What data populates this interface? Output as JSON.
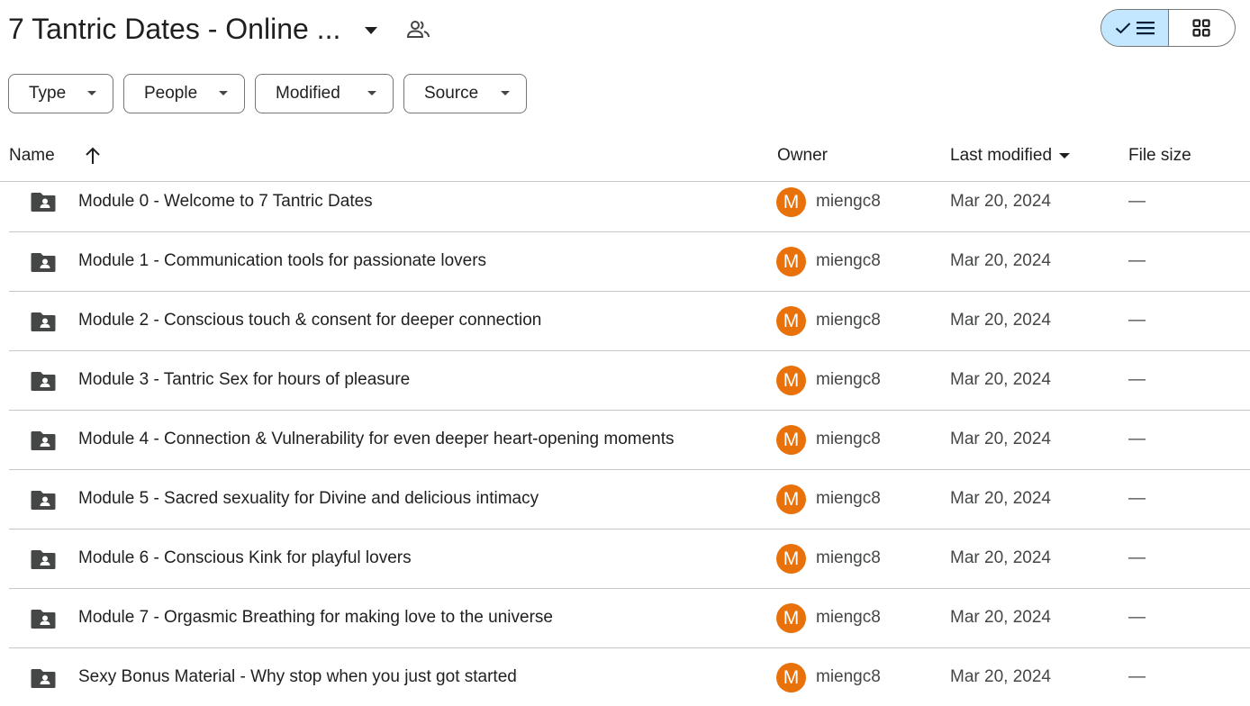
{
  "header": {
    "title": "7 Tantric Dates - Online ...",
    "caret_icon": "arrow-drop-down-icon",
    "shared_icon": "people-outline-icon",
    "view_toggle": {
      "list_icon": "check-list-icon",
      "grid_icon": "grid-view-icon",
      "selected": "list"
    }
  },
  "filters": [
    {
      "label": "Type"
    },
    {
      "label": "People"
    },
    {
      "label": "Modified"
    },
    {
      "label": "Source"
    }
  ],
  "columns": {
    "name": "Name",
    "owner": "Owner",
    "last_modified": "Last modified",
    "file_size": "File size",
    "sort_icon": "arrow-upward-icon"
  },
  "rows": [
    {
      "name": "Module 0 - Welcome to 7 Tantric Dates",
      "owner_initial": "M",
      "owner": "miengc8",
      "modified": "Mar 20, 2024",
      "size": "—"
    },
    {
      "name": "Module 1 - Communication tools for passionate lovers",
      "owner_initial": "M",
      "owner": "miengc8",
      "modified": "Mar 20, 2024",
      "size": "—"
    },
    {
      "name": "Module 2 - Conscious touch & consent for deeper connection",
      "owner_initial": "M",
      "owner": "miengc8",
      "modified": "Mar 20, 2024",
      "size": "—"
    },
    {
      "name": "Module 3 - Tantric Sex for hours of pleasure",
      "owner_initial": "M",
      "owner": "miengc8",
      "modified": "Mar 20, 2024",
      "size": "—"
    },
    {
      "name": "Module 4 - Connection & Vulnerability for even deeper heart-opening moments",
      "owner_initial": "M",
      "owner": "miengc8",
      "modified": "Mar 20, 2024",
      "size": "—"
    },
    {
      "name": "Module 5 - Sacred sexuality for Divine and delicious intimacy",
      "owner_initial": "M",
      "owner": "miengc8",
      "modified": "Mar 20, 2024",
      "size": "—"
    },
    {
      "name": "Module 6 - Conscious Kink for playful lovers",
      "owner_initial": "M",
      "owner": "miengc8",
      "modified": "Mar 20, 2024",
      "size": "—"
    },
    {
      "name": "Module 7 - Orgasmic Breathing for making love to the universe",
      "owner_initial": "M",
      "owner": "miengc8",
      "modified": "Mar 20, 2024",
      "size": "—"
    },
    {
      "name": "Sexy Bonus Material - Why stop when you just got started",
      "owner_initial": "M",
      "owner": "miengc8",
      "modified": "Mar 20, 2024",
      "size": "—"
    }
  ],
  "colors": {
    "avatar": "#e8710a",
    "selected_toggle": "#c2e7ff",
    "border": "#747775",
    "divider": "#c4c7c5"
  }
}
